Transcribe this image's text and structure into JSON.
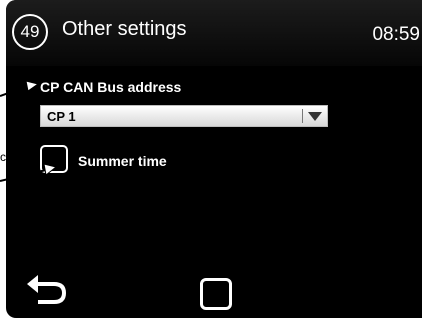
{
  "header": {
    "screen_number": "49",
    "title": "Other settings",
    "time": "08:59"
  },
  "can_bus": {
    "label": "CP CAN Bus address",
    "selected_value": "CP  1"
  },
  "summer_time": {
    "label": "Summer time",
    "checked": false
  },
  "callouts": {
    "clipped_letter": "c"
  },
  "icons": {
    "back": "back-arrow-icon",
    "home": "home-square-icon",
    "dropdown": "triangle-down-icon"
  },
  "colors": {
    "screen_background": "#000000",
    "text": "#ffffff",
    "select_background": "#e6e6e6"
  }
}
